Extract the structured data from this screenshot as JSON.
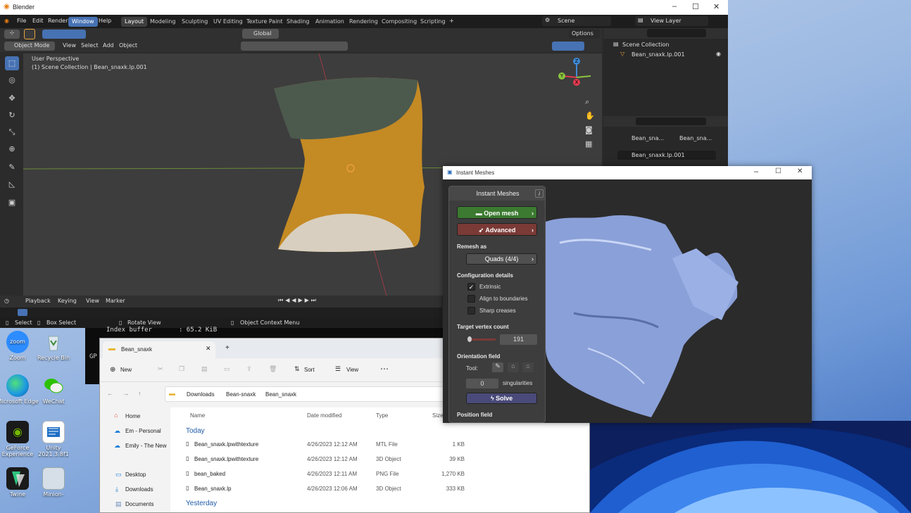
{
  "desktop": {
    "icons": [
      {
        "label": "Zoom",
        "color": "#2d8cff"
      },
      {
        "label": "Recycle Bin",
        "color": "#cfd8e4"
      },
      {
        "label": "Microsoft Edge",
        "color": "#1e9be0"
      },
      {
        "label": "WeChat",
        "color": "#2dc100"
      },
      {
        "label": "GeForce Experience",
        "color": "#76b900"
      },
      {
        "label": "Unity 2021.3.8f1",
        "color": "#1f6fc5"
      },
      {
        "label": "Twine",
        "color": "#1a1a1a"
      },
      {
        "label": "Minion-",
        "color": "#c9d4e0"
      }
    ]
  },
  "blender": {
    "title": "Blender",
    "menu": [
      "File",
      "Edit",
      "Render",
      "Window",
      "Help"
    ],
    "active_menu": "Window",
    "workspaces": [
      "Layout",
      "Modeling",
      "Sculpting",
      "UV Editing",
      "Texture Paint",
      "Shading",
      "Animation",
      "Rendering",
      "Compositing",
      "Scripting"
    ],
    "active_workspace": "Layout",
    "scene": "Scene",
    "view_layer": "View Layer",
    "transform_orientation": "Global",
    "options": "Options",
    "mode": "Object Mode",
    "viewport_menus": [
      "View",
      "Select",
      "Add",
      "Object"
    ],
    "viewport_info": [
      "User Perspective",
      "(1) Scene Collection | Bean_snaxk.lp.001"
    ],
    "timeline_menus": [
      "Playback",
      "Keying",
      "View",
      "Marker"
    ],
    "status": [
      "Select",
      "Box Select",
      "Rotate View",
      "Object Context Menu"
    ],
    "outliner": {
      "collection": "Scene Collection",
      "object": "Bean_snaxk.lp.001"
    },
    "properties": {
      "tab1": "Bean_sna...",
      "tab2": "Bean_sna...",
      "object": "Bean_snaxk.lp.001"
    },
    "axis": {
      "x": "X",
      "y": "Y",
      "z": "Z"
    },
    "colors": {
      "accent": "#4772b3",
      "x_axis": "#e33a4f",
      "y_axis": "#8bc53f",
      "z_axis": "#3f8bd6"
    }
  },
  "terminal": {
    "lines": [
      "Index buffer       : 65.2 KiB"
    ],
    "gpu_prefix": "GP"
  },
  "instant_meshes": {
    "title": "Instant Meshes",
    "panel_title": "Instant Meshes",
    "info_icon": "i",
    "open_mesh": "Open mesh",
    "advanced": "Advanced",
    "remesh_as_label": "Remesh as",
    "remesh_as_value": "Quads (4/4)",
    "config_label": "Configuration details",
    "options": [
      {
        "label": "Extrinsic",
        "checked": true
      },
      {
        "label": "Align to boundaries",
        "checked": false
      },
      {
        "label": "Sharp creases",
        "checked": false
      }
    ],
    "target_label": "Target vertex count",
    "target_value": "191",
    "orientation_label": "Orientation field",
    "tool_label": "Tool:",
    "singularities_value": "0",
    "singularities_label": "singularities",
    "solve": "Solve",
    "position_label": "Position field",
    "colors": {
      "open_mesh": "#3b7a30",
      "advanced": "#7a3a36",
      "solve": "#4a4a7a",
      "mesh": "#8aa0d8"
    }
  },
  "explorer": {
    "tab": "Bean_snaxk",
    "toolbar": {
      "new": "New",
      "sort": "Sort",
      "view": "View"
    },
    "path": [
      "Downloads",
      "Bean-snaxk",
      "Bean_snaxk"
    ],
    "nav": [
      "Home",
      "Em - Personal",
      "Emily - The New",
      "Desktop",
      "Downloads",
      "Documents"
    ],
    "columns": [
      "Name",
      "Date modified",
      "Type",
      "Size"
    ],
    "groups": {
      "today": "Today",
      "yesterday": "Yesterday"
    },
    "files": [
      {
        "name": "Bean_snaxk.lpwithtexture",
        "date": "4/26/2023 12:12 AM",
        "type": "MTL File",
        "size": "1 KB"
      },
      {
        "name": "Bean_snaxk.lpwithtexture",
        "date": "4/26/2023 12:12 AM",
        "type": "3D Object",
        "size": "39 KB"
      },
      {
        "name": "bean_baked",
        "date": "4/26/2023 12:11 AM",
        "type": "PNG File",
        "size": "1,270 KB"
      },
      {
        "name": "Bean_snaxk.lp",
        "date": "4/26/2023 12:06 AM",
        "type": "3D Object",
        "size": "333 KB"
      }
    ]
  }
}
